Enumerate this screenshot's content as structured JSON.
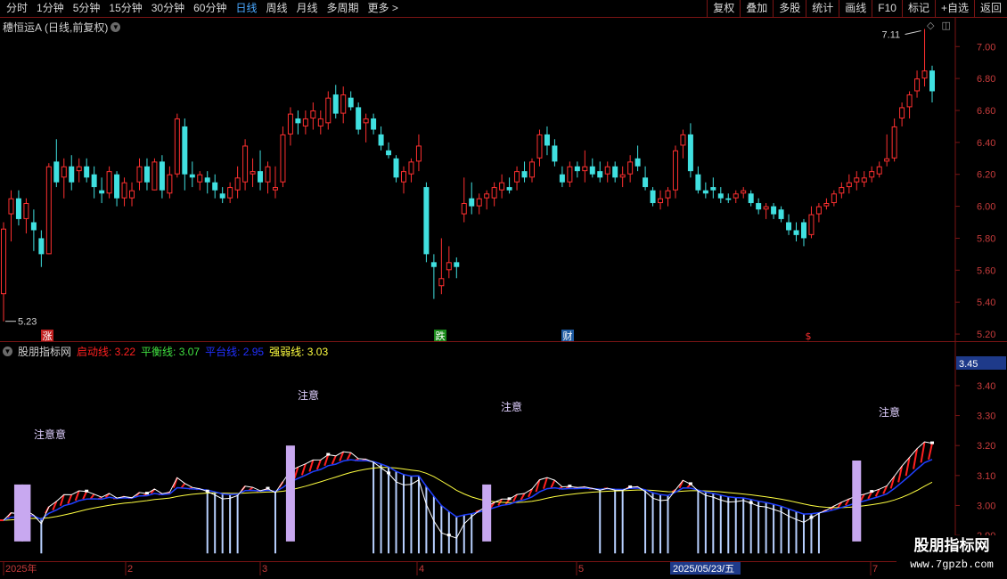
{
  "toolbar": {
    "left_items": [
      "分时",
      "1分钟",
      "5分钟",
      "15分钟",
      "30分钟",
      "60分钟",
      "日线",
      "周线",
      "月线",
      "多周期",
      "更多 >"
    ],
    "active_item": "日线",
    "right_items": [
      "复权",
      "叠加",
      "多股",
      "统计",
      "画线",
      "F10",
      "标记",
      "+自选",
      "返回"
    ]
  },
  "stock": {
    "title": "穗恒运A",
    "subtitle": "(日线,前复权)"
  },
  "price_axis": {
    "labels": [
      "7.00",
      "6.80",
      "6.60",
      "6.40",
      "6.20",
      "6.00",
      "5.80",
      "5.60",
      "5.40",
      "5.20"
    ],
    "high_marker": "7.11",
    "low_marker": "5.23"
  },
  "event_markers": [
    {
      "label": "涨",
      "color": "#c02020"
    },
    {
      "label": "跌",
      "color": "#1a8a1a"
    },
    {
      "label": "财",
      "color": "#1d5aa0"
    },
    {
      "label": "$",
      "color": "#ff3030"
    }
  ],
  "indicator": {
    "name": "股朋指标网",
    "lines": [
      {
        "label": "启动线:",
        "value": "3.22",
        "color": "#ff2020"
      },
      {
        "label": "平衡线:",
        "value": "3.07",
        "color": "#40e040"
      },
      {
        "label": "平台线:",
        "value": "2.95",
        "color": "#2030ff"
      },
      {
        "label": "强弱线:",
        "value": "3.03",
        "color": "#ffff40"
      }
    ],
    "axis_labels": [
      "3.40",
      "3.30",
      "3.20",
      "3.10",
      "3.00",
      "2.90"
    ],
    "current_value": "3.45",
    "attention_labels": [
      "注意意",
      "注意",
      "注意",
      "注意"
    ]
  },
  "date_axis": {
    "labels": [
      "2025年",
      "2",
      "3",
      "4",
      "5",
      "7"
    ],
    "current_date": "2025/05/23/五"
  },
  "watermark": {
    "line1": "股朋指标网",
    "line2": "www.7gpzb.com"
  },
  "colors": {
    "up": "#ff3030",
    "down": "#40e0e0",
    "grid": "#7a1414",
    "axis_text": "#c83c3c"
  },
  "chart_data": {
    "type": "candlestick",
    "description_ohlc": "open, high, low, close per trading day",
    "ylim": [
      5.15,
      7.18
    ],
    "candles": [
      [
        5.45,
        5.9,
        5.28,
        5.86
      ],
      [
        5.95,
        6.1,
        5.78,
        6.05
      ],
      [
        6.05,
        6.1,
        5.88,
        5.92
      ],
      [
        5.92,
        6.05,
        5.83,
        6.02
      ],
      [
        5.9,
        5.98,
        5.72,
        5.85
      ],
      [
        5.8,
        5.85,
        5.62,
        5.7
      ],
      [
        5.7,
        6.27,
        5.7,
        6.25
      ],
      [
        6.28,
        6.42,
        6.12,
        6.15
      ],
      [
        6.18,
        6.3,
        6.05,
        6.25
      ],
      [
        6.25,
        6.32,
        6.1,
        6.15
      ],
      [
        6.22,
        6.3,
        6.15,
        6.25
      ],
      [
        6.25,
        6.3,
        6.15,
        6.18
      ],
      [
        6.2,
        6.25,
        6.05,
        6.12
      ],
      [
        6.1,
        6.18,
        6.02,
        6.08
      ],
      [
        6.08,
        6.25,
        6.05,
        6.22
      ],
      [
        6.2,
        6.22,
        6.0,
        6.05
      ],
      [
        6.05,
        6.18,
        6.0,
        6.15
      ],
      [
        6.05,
        6.15,
        6.0,
        6.1
      ],
      [
        6.15,
        6.3,
        6.1,
        6.25
      ],
      [
        6.25,
        6.3,
        6.1,
        6.15
      ],
      [
        6.1,
        6.3,
        6.1,
        6.28
      ],
      [
        6.28,
        6.32,
        6.05,
        6.1
      ],
      [
        6.08,
        6.25,
        6.05,
        6.2
      ],
      [
        6.2,
        6.58,
        6.18,
        6.55
      ],
      [
        6.5,
        6.55,
        6.1,
        6.2
      ],
      [
        6.2,
        6.28,
        6.12,
        6.18
      ],
      [
        6.15,
        6.22,
        6.1,
        6.2
      ],
      [
        6.18,
        6.22,
        6.08,
        6.15
      ],
      [
        6.15,
        6.2,
        6.05,
        6.1
      ],
      [
        6.08,
        6.12,
        6.02,
        6.05
      ],
      [
        6.05,
        6.15,
        6.02,
        6.12
      ],
      [
        6.1,
        6.25,
        6.05,
        6.18
      ],
      [
        6.15,
        6.42,
        6.1,
        6.38
      ],
      [
        6.2,
        6.3,
        6.12,
        6.22
      ],
      [
        6.22,
        6.35,
        6.1,
        6.15
      ],
      [
        6.15,
        6.28,
        6.08,
        6.25
      ],
      [
        6.1,
        6.25,
        6.05,
        6.12
      ],
      [
        6.15,
        6.5,
        6.12,
        6.45
      ],
      [
        6.45,
        6.62,
        6.38,
        6.58
      ],
      [
        6.55,
        6.6,
        6.45,
        6.52
      ],
      [
        6.5,
        6.6,
        6.45,
        6.55
      ],
      [
        6.55,
        6.65,
        6.48,
        6.6
      ],
      [
        6.5,
        6.6,
        6.45,
        6.55
      ],
      [
        6.52,
        6.72,
        6.48,
        6.68
      ],
      [
        6.7,
        6.76,
        6.55,
        6.58
      ],
      [
        6.58,
        6.75,
        6.52,
        6.7
      ],
      [
        6.68,
        6.72,
        6.6,
        6.62
      ],
      [
        6.62,
        6.65,
        6.45,
        6.48
      ],
      [
        6.52,
        6.58,
        6.4,
        6.55
      ],
      [
        6.55,
        6.58,
        6.45,
        6.48
      ],
      [
        6.45,
        6.5,
        6.35,
        6.38
      ],
      [
        6.35,
        6.4,
        6.3,
        6.32
      ],
      [
        6.3,
        6.32,
        6.15,
        6.18
      ],
      [
        6.15,
        6.25,
        6.08,
        6.22
      ],
      [
        6.2,
        6.3,
        6.15,
        6.28
      ],
      [
        6.28,
        6.45,
        6.22,
        6.38
      ],
      [
        6.12,
        6.15,
        5.65,
        5.7
      ],
      [
        5.65,
        5.7,
        5.42,
        5.62
      ],
      [
        5.5,
        5.8,
        5.45,
        5.55
      ],
      [
        5.6,
        5.75,
        5.55,
        5.65
      ],
      [
        5.65,
        5.68,
        5.55,
        5.62
      ],
      [
        5.95,
        6.18,
        5.9,
        6.02
      ],
      [
        6.05,
        6.15,
        5.95,
        6.0
      ],
      [
        6.0,
        6.08,
        5.95,
        6.05
      ],
      [
        6.05,
        6.1,
        5.98,
        6.08
      ],
      [
        6.05,
        6.15,
        6.0,
        6.12
      ],
      [
        6.1,
        6.2,
        6.05,
        6.15
      ],
      [
        6.12,
        6.18,
        6.08,
        6.1
      ],
      [
        6.15,
        6.25,
        6.1,
        6.22
      ],
      [
        6.22,
        6.28,
        6.15,
        6.18
      ],
      [
        6.18,
        6.3,
        6.15,
        6.28
      ],
      [
        6.3,
        6.48,
        6.25,
        6.45
      ],
      [
        6.45,
        6.5,
        6.32,
        6.38
      ],
      [
        6.38,
        6.42,
        6.25,
        6.28
      ],
      [
        6.2,
        6.25,
        6.12,
        6.15
      ],
      [
        6.15,
        6.28,
        6.12,
        6.25
      ],
      [
        6.25,
        6.28,
        6.18,
        6.22
      ],
      [
        6.22,
        6.35,
        6.15,
        6.25
      ],
      [
        6.25,
        6.3,
        6.18,
        6.2
      ],
      [
        6.22,
        6.28,
        6.15,
        6.18
      ],
      [
        6.2,
        6.28,
        6.15,
        6.25
      ],
      [
        6.25,
        6.28,
        6.15,
        6.18
      ],
      [
        6.18,
        6.25,
        6.12,
        6.2
      ],
      [
        6.2,
        6.32,
        6.15,
        6.28
      ],
      [
        6.3,
        6.38,
        6.22,
        6.25
      ],
      [
        6.18,
        6.25,
        6.1,
        6.12
      ],
      [
        6.1,
        6.12,
        6.0,
        6.02
      ],
      [
        6.02,
        6.1,
        5.98,
        6.05
      ],
      [
        6.05,
        6.12,
        6.0,
        6.1
      ],
      [
        6.1,
        6.38,
        6.05,
        6.35
      ],
      [
        6.38,
        6.48,
        6.3,
        6.45
      ],
      [
        6.45,
        6.52,
        6.18,
        6.22
      ],
      [
        6.2,
        6.25,
        6.08,
        6.1
      ],
      [
        6.1,
        6.15,
        6.05,
        6.08
      ],
      [
        6.12,
        6.18,
        6.05,
        6.1
      ],
      [
        6.08,
        6.12,
        6.02,
        6.05
      ],
      [
        6.05,
        6.08,
        6.02,
        6.04
      ],
      [
        6.05,
        6.1,
        6.02,
        6.08
      ],
      [
        6.08,
        6.12,
        6.05,
        6.1
      ],
      [
        6.08,
        6.1,
        6.0,
        6.02
      ],
      [
        6.02,
        6.05,
        5.95,
        5.98
      ],
      [
        5.98,
        6.02,
        5.92,
        6.0
      ],
      [
        6.0,
        6.02,
        5.92,
        5.95
      ],
      [
        5.98,
        6.0,
        5.9,
        5.92
      ],
      [
        5.9,
        5.95,
        5.82,
        5.85
      ],
      [
        5.85,
        5.9,
        5.78,
        5.82
      ],
      [
        5.9,
        5.92,
        5.75,
        5.8
      ],
      [
        5.82,
        6.0,
        5.8,
        5.95
      ],
      [
        5.95,
        6.02,
        5.9,
        6.0
      ],
      [
        6.0,
        6.05,
        5.98,
        6.02
      ],
      [
        6.02,
        6.1,
        6.0,
        6.08
      ],
      [
        6.08,
        6.15,
        6.05,
        6.12
      ],
      [
        6.12,
        6.2,
        6.08,
        6.15
      ],
      [
        6.15,
        6.22,
        6.1,
        6.18
      ],
      [
        6.15,
        6.22,
        6.12,
        6.18
      ],
      [
        6.18,
        6.25,
        6.15,
        6.22
      ],
      [
        6.2,
        6.28,
        6.18,
        6.25
      ],
      [
        6.28,
        6.45,
        6.25,
        6.3
      ],
      [
        6.3,
        6.55,
        6.28,
        6.5
      ],
      [
        6.55,
        6.65,
        6.5,
        6.62
      ],
      [
        6.62,
        6.72,
        6.55,
        6.7
      ],
      [
        6.72,
        6.85,
        6.68,
        6.8
      ],
      [
        6.8,
        7.11,
        6.75,
        6.85
      ],
      [
        6.85,
        6.88,
        6.65,
        6.72
      ]
    ],
    "indicator_series": {
      "attention_days": [
        2,
        3,
        38,
        64,
        113
      ]
    }
  }
}
